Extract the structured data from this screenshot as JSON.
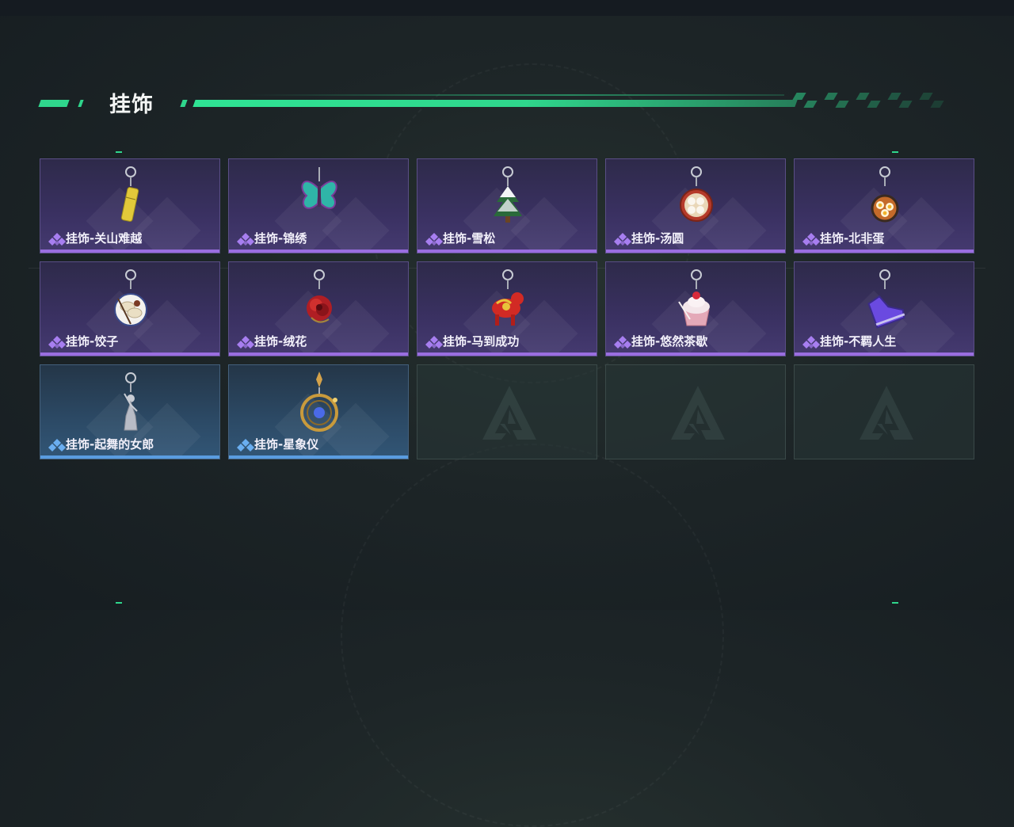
{
  "section": {
    "title": "挂饰"
  },
  "colors": {
    "accent": "#2fd68c",
    "purple_rarity": "#9a6ee0",
    "blue_rarity": "#5a9ce0"
  },
  "items": [
    {
      "label": "挂饰-关山难越",
      "rarity": "purple",
      "icon": "gold-bar-charm-icon"
    },
    {
      "label": "挂饰-锦绣",
      "rarity": "purple",
      "icon": "butterfly-charm-icon"
    },
    {
      "label": "挂饰-雪松",
      "rarity": "purple",
      "icon": "snowy-pine-charm-icon"
    },
    {
      "label": "挂饰-汤圆",
      "rarity": "purple",
      "icon": "tangyuan-bowl-charm-icon"
    },
    {
      "label": "挂饰-北非蛋",
      "rarity": "purple",
      "icon": "shakshuka-charm-icon"
    },
    {
      "label": "挂饰-饺子",
      "rarity": "purple",
      "icon": "dumpling-plate-charm-icon"
    },
    {
      "label": "挂饰-绒花",
      "rarity": "purple",
      "icon": "velvet-flower-charm-icon"
    },
    {
      "label": "挂饰-马到成功",
      "rarity": "purple",
      "icon": "red-horse-charm-icon"
    },
    {
      "label": "挂饰-悠然茶歇",
      "rarity": "purple",
      "icon": "cupcake-charm-icon"
    },
    {
      "label": "挂饰-不羁人生",
      "rarity": "purple",
      "icon": "sneaker-charm-icon"
    },
    {
      "label": "挂饰-起舞的女郎",
      "rarity": "blue",
      "icon": "dancer-statue-charm-icon"
    },
    {
      "label": "挂饰-星象仪",
      "rarity": "blue",
      "icon": "astrolabe-charm-icon"
    },
    {
      "label": "",
      "rarity": "empty",
      "icon": "game-logo-placeholder-icon"
    },
    {
      "label": "",
      "rarity": "empty",
      "icon": "game-logo-placeholder-icon"
    },
    {
      "label": "",
      "rarity": "empty",
      "icon": "game-logo-placeholder-icon"
    }
  ]
}
